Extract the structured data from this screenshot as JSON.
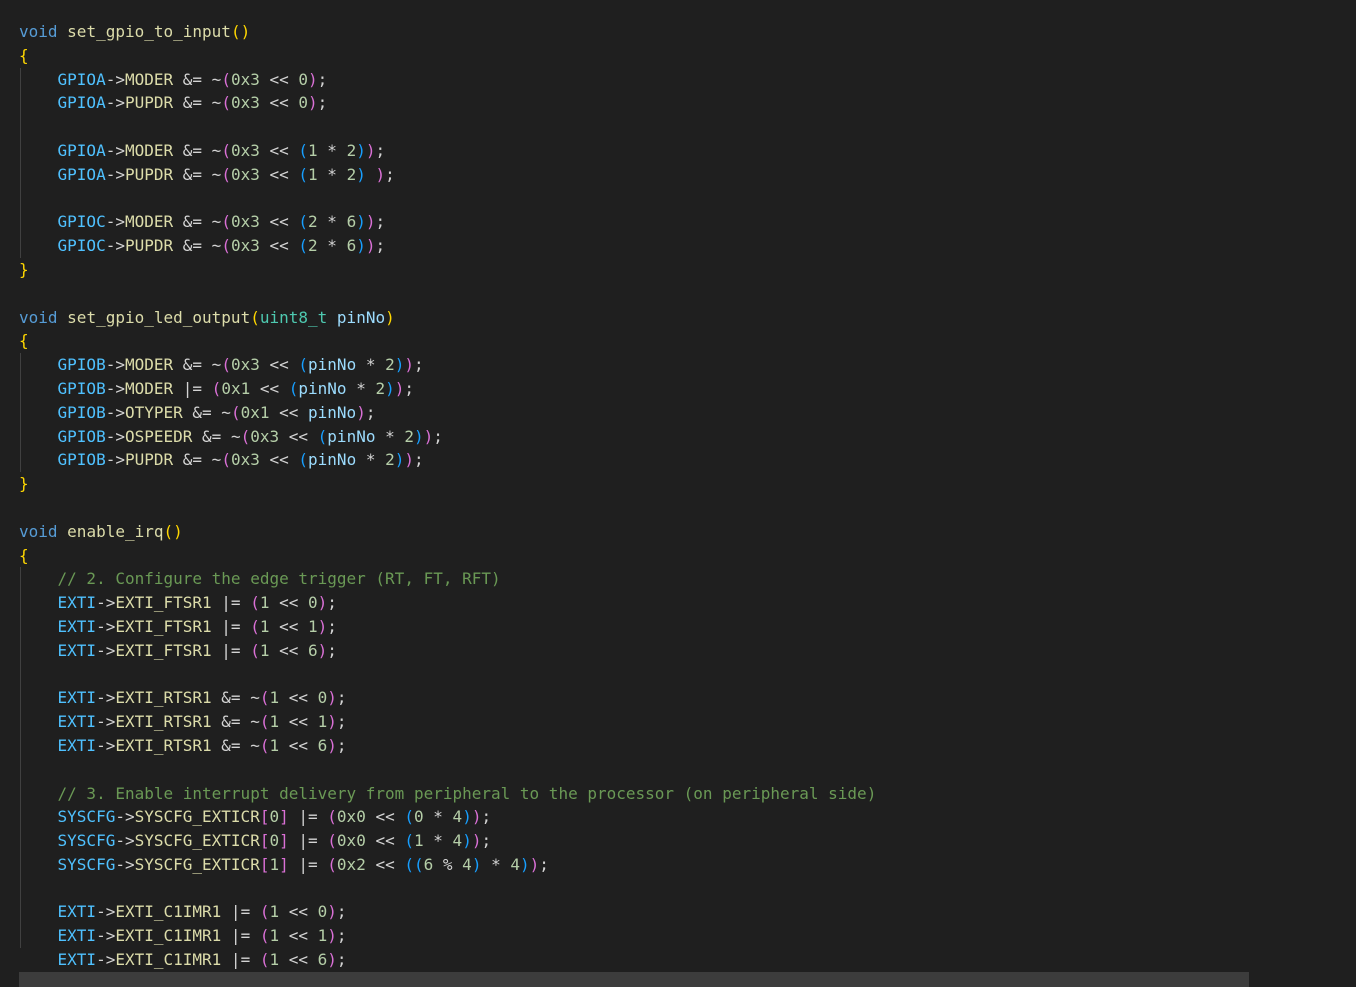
{
  "colors": {
    "background": "#1f1f1f",
    "keyword": "#569cd6",
    "function": "#dcdcaa",
    "type": "#4ec9b0",
    "variable": "#9cdcfe",
    "constant": "#4fc1ff",
    "member": "#dcdcaa",
    "number": "#b5cea8",
    "comment": "#6a9955",
    "bracket_level1": "#ffd700",
    "bracket_level2": "#da70d6",
    "bracket_level3": "#179fff"
  },
  "code_lines": [
    [
      [
        "kw",
        "void"
      ],
      [
        "plain",
        " "
      ],
      [
        "fn",
        "set_gpio_to_input"
      ],
      [
        "br1",
        "()"
      ]
    ],
    [
      [
        "br1",
        "{"
      ]
    ],
    [
      [
        "plain",
        "    "
      ],
      [
        "const",
        "GPIOA"
      ],
      [
        "op",
        "->"
      ],
      [
        "mem",
        "MODER"
      ],
      [
        "op",
        " &= ~"
      ],
      [
        "br2",
        "("
      ],
      [
        "num",
        "0x3"
      ],
      [
        "op",
        " << "
      ],
      [
        "num",
        "0"
      ],
      [
        "br2",
        ")"
      ],
      [
        "op",
        ";"
      ]
    ],
    [
      [
        "plain",
        "    "
      ],
      [
        "const",
        "GPIOA"
      ],
      [
        "op",
        "->"
      ],
      [
        "mem",
        "PUPDR"
      ],
      [
        "op",
        " &= ~"
      ],
      [
        "br2",
        "("
      ],
      [
        "num",
        "0x3"
      ],
      [
        "op",
        " << "
      ],
      [
        "num",
        "0"
      ],
      [
        "br2",
        ")"
      ],
      [
        "op",
        ";"
      ]
    ],
    [],
    [
      [
        "plain",
        "    "
      ],
      [
        "const",
        "GPIOA"
      ],
      [
        "op",
        "->"
      ],
      [
        "mem",
        "MODER"
      ],
      [
        "op",
        " &= ~"
      ],
      [
        "br2",
        "("
      ],
      [
        "num",
        "0x3"
      ],
      [
        "op",
        " << "
      ],
      [
        "br3",
        "("
      ],
      [
        "num",
        "1"
      ],
      [
        "op",
        " * "
      ],
      [
        "num",
        "2"
      ],
      [
        "br3",
        ")"
      ],
      [
        "br2",
        ")"
      ],
      [
        "op",
        ";"
      ]
    ],
    [
      [
        "plain",
        "    "
      ],
      [
        "const",
        "GPIOA"
      ],
      [
        "op",
        "->"
      ],
      [
        "mem",
        "PUPDR"
      ],
      [
        "op",
        " &= ~"
      ],
      [
        "br2",
        "("
      ],
      [
        "num",
        "0x3"
      ],
      [
        "op",
        " << "
      ],
      [
        "br3",
        "("
      ],
      [
        "num",
        "1"
      ],
      [
        "op",
        " * "
      ],
      [
        "num",
        "2"
      ],
      [
        "br3",
        ")"
      ],
      [
        "plain",
        " "
      ],
      [
        "br2",
        ")"
      ],
      [
        "op",
        ";"
      ]
    ],
    [],
    [
      [
        "plain",
        "    "
      ],
      [
        "const",
        "GPIOC"
      ],
      [
        "op",
        "->"
      ],
      [
        "mem",
        "MODER"
      ],
      [
        "op",
        " &= ~"
      ],
      [
        "br2",
        "("
      ],
      [
        "num",
        "0x3"
      ],
      [
        "op",
        " << "
      ],
      [
        "br3",
        "("
      ],
      [
        "num",
        "2"
      ],
      [
        "op",
        " * "
      ],
      [
        "num",
        "6"
      ],
      [
        "br3",
        ")"
      ],
      [
        "br2",
        ")"
      ],
      [
        "op",
        ";"
      ]
    ],
    [
      [
        "plain",
        "    "
      ],
      [
        "const",
        "GPIOC"
      ],
      [
        "op",
        "->"
      ],
      [
        "mem",
        "PUPDR"
      ],
      [
        "op",
        " &= ~"
      ],
      [
        "br2",
        "("
      ],
      [
        "num",
        "0x3"
      ],
      [
        "op",
        " << "
      ],
      [
        "br3",
        "("
      ],
      [
        "num",
        "2"
      ],
      [
        "op",
        " * "
      ],
      [
        "num",
        "6"
      ],
      [
        "br3",
        ")"
      ],
      [
        "br2",
        ")"
      ],
      [
        "op",
        ";"
      ]
    ],
    [
      [
        "br1",
        "}"
      ]
    ],
    [],
    [
      [
        "kw",
        "void"
      ],
      [
        "plain",
        " "
      ],
      [
        "fn",
        "set_gpio_led_output"
      ],
      [
        "br1",
        "("
      ],
      [
        "type",
        "uint8_t"
      ],
      [
        "plain",
        " "
      ],
      [
        "var",
        "pinNo"
      ],
      [
        "br1",
        ")"
      ]
    ],
    [
      [
        "br1",
        "{"
      ]
    ],
    [
      [
        "plain",
        "    "
      ],
      [
        "const",
        "GPIOB"
      ],
      [
        "op",
        "->"
      ],
      [
        "mem",
        "MODER"
      ],
      [
        "op",
        " &= ~"
      ],
      [
        "br2",
        "("
      ],
      [
        "num",
        "0x3"
      ],
      [
        "op",
        " << "
      ],
      [
        "br3",
        "("
      ],
      [
        "var",
        "pinNo"
      ],
      [
        "op",
        " * "
      ],
      [
        "num",
        "2"
      ],
      [
        "br3",
        ")"
      ],
      [
        "br2",
        ")"
      ],
      [
        "op",
        ";"
      ]
    ],
    [
      [
        "plain",
        "    "
      ],
      [
        "const",
        "GPIOB"
      ],
      [
        "op",
        "->"
      ],
      [
        "mem",
        "MODER"
      ],
      [
        "op",
        " |= "
      ],
      [
        "br2",
        "("
      ],
      [
        "num",
        "0x1"
      ],
      [
        "op",
        " << "
      ],
      [
        "br3",
        "("
      ],
      [
        "var",
        "pinNo"
      ],
      [
        "op",
        " * "
      ],
      [
        "num",
        "2"
      ],
      [
        "br3",
        ")"
      ],
      [
        "br2",
        ")"
      ],
      [
        "op",
        ";"
      ]
    ],
    [
      [
        "plain",
        "    "
      ],
      [
        "const",
        "GPIOB"
      ],
      [
        "op",
        "->"
      ],
      [
        "mem",
        "OTYPER"
      ],
      [
        "op",
        " &= ~"
      ],
      [
        "br2",
        "("
      ],
      [
        "num",
        "0x1"
      ],
      [
        "op",
        " << "
      ],
      [
        "var",
        "pinNo"
      ],
      [
        "br2",
        ")"
      ],
      [
        "op",
        ";"
      ]
    ],
    [
      [
        "plain",
        "    "
      ],
      [
        "const",
        "GPIOB"
      ],
      [
        "op",
        "->"
      ],
      [
        "mem",
        "OSPEEDR"
      ],
      [
        "op",
        " &= ~"
      ],
      [
        "br2",
        "("
      ],
      [
        "num",
        "0x3"
      ],
      [
        "op",
        " << "
      ],
      [
        "br3",
        "("
      ],
      [
        "var",
        "pinNo"
      ],
      [
        "op",
        " * "
      ],
      [
        "num",
        "2"
      ],
      [
        "br3",
        ")"
      ],
      [
        "br2",
        ")"
      ],
      [
        "op",
        ";"
      ]
    ],
    [
      [
        "plain",
        "    "
      ],
      [
        "const",
        "GPIOB"
      ],
      [
        "op",
        "->"
      ],
      [
        "mem",
        "PUPDR"
      ],
      [
        "op",
        " &= ~"
      ],
      [
        "br2",
        "("
      ],
      [
        "num",
        "0x3"
      ],
      [
        "op",
        " << "
      ],
      [
        "br3",
        "("
      ],
      [
        "var",
        "pinNo"
      ],
      [
        "op",
        " * "
      ],
      [
        "num",
        "2"
      ],
      [
        "br3",
        ")"
      ],
      [
        "br2",
        ")"
      ],
      [
        "op",
        ";"
      ]
    ],
    [
      [
        "br1",
        "}"
      ]
    ],
    [],
    [
      [
        "kw",
        "void"
      ],
      [
        "plain",
        " "
      ],
      [
        "fn",
        "enable_irq"
      ],
      [
        "br1",
        "()"
      ]
    ],
    [
      [
        "br1",
        "{"
      ]
    ],
    [
      [
        "plain",
        "    "
      ],
      [
        "comment",
        "// 2. Configure the edge trigger (RT, FT, RFT)"
      ]
    ],
    [
      [
        "plain",
        "    "
      ],
      [
        "const",
        "EXTI"
      ],
      [
        "op",
        "->"
      ],
      [
        "mem",
        "EXTI_FTSR1"
      ],
      [
        "op",
        " |= "
      ],
      [
        "br2",
        "("
      ],
      [
        "num",
        "1"
      ],
      [
        "op",
        " << "
      ],
      [
        "num",
        "0"
      ],
      [
        "br2",
        ")"
      ],
      [
        "op",
        ";"
      ]
    ],
    [
      [
        "plain",
        "    "
      ],
      [
        "const",
        "EXTI"
      ],
      [
        "op",
        "->"
      ],
      [
        "mem",
        "EXTI_FTSR1"
      ],
      [
        "op",
        " |= "
      ],
      [
        "br2",
        "("
      ],
      [
        "num",
        "1"
      ],
      [
        "op",
        " << "
      ],
      [
        "num",
        "1"
      ],
      [
        "br2",
        ")"
      ],
      [
        "op",
        ";"
      ]
    ],
    [
      [
        "plain",
        "    "
      ],
      [
        "const",
        "EXTI"
      ],
      [
        "op",
        "->"
      ],
      [
        "mem",
        "EXTI_FTSR1"
      ],
      [
        "op",
        " |= "
      ],
      [
        "br2",
        "("
      ],
      [
        "num",
        "1"
      ],
      [
        "op",
        " << "
      ],
      [
        "num",
        "6"
      ],
      [
        "br2",
        ")"
      ],
      [
        "op",
        ";"
      ]
    ],
    [],
    [
      [
        "plain",
        "    "
      ],
      [
        "const",
        "EXTI"
      ],
      [
        "op",
        "->"
      ],
      [
        "mem",
        "EXTI_RTSR1"
      ],
      [
        "op",
        " &= ~"
      ],
      [
        "br2",
        "("
      ],
      [
        "num",
        "1"
      ],
      [
        "op",
        " << "
      ],
      [
        "num",
        "0"
      ],
      [
        "br2",
        ")"
      ],
      [
        "op",
        ";"
      ]
    ],
    [
      [
        "plain",
        "    "
      ],
      [
        "const",
        "EXTI"
      ],
      [
        "op",
        "->"
      ],
      [
        "mem",
        "EXTI_RTSR1"
      ],
      [
        "op",
        " &= ~"
      ],
      [
        "br2",
        "("
      ],
      [
        "num",
        "1"
      ],
      [
        "op",
        " << "
      ],
      [
        "num",
        "1"
      ],
      [
        "br2",
        ")"
      ],
      [
        "op",
        ";"
      ]
    ],
    [
      [
        "plain",
        "    "
      ],
      [
        "const",
        "EXTI"
      ],
      [
        "op",
        "->"
      ],
      [
        "mem",
        "EXTI_RTSR1"
      ],
      [
        "op",
        " &= ~"
      ],
      [
        "br2",
        "("
      ],
      [
        "num",
        "1"
      ],
      [
        "op",
        " << "
      ],
      [
        "num",
        "6"
      ],
      [
        "br2",
        ")"
      ],
      [
        "op",
        ";"
      ]
    ],
    [],
    [
      [
        "plain",
        "    "
      ],
      [
        "comment",
        "// 3. Enable interrupt delivery from peripheral to the processor (on peripheral side)"
      ]
    ],
    [
      [
        "plain",
        "    "
      ],
      [
        "const",
        "SYSCFG"
      ],
      [
        "op",
        "->"
      ],
      [
        "mem",
        "SYSCFG_EXTICR"
      ],
      [
        "br2",
        "["
      ],
      [
        "num",
        "0"
      ],
      [
        "br2",
        "]"
      ],
      [
        "op",
        " |= "
      ],
      [
        "br2",
        "("
      ],
      [
        "num",
        "0x0"
      ],
      [
        "op",
        " << "
      ],
      [
        "br3",
        "("
      ],
      [
        "num",
        "0"
      ],
      [
        "op",
        " * "
      ],
      [
        "num",
        "4"
      ],
      [
        "br3",
        ")"
      ],
      [
        "br2",
        ")"
      ],
      [
        "op",
        ";"
      ]
    ],
    [
      [
        "plain",
        "    "
      ],
      [
        "const",
        "SYSCFG"
      ],
      [
        "op",
        "->"
      ],
      [
        "mem",
        "SYSCFG_EXTICR"
      ],
      [
        "br2",
        "["
      ],
      [
        "num",
        "0"
      ],
      [
        "br2",
        "]"
      ],
      [
        "op",
        " |= "
      ],
      [
        "br2",
        "("
      ],
      [
        "num",
        "0x0"
      ],
      [
        "op",
        " << "
      ],
      [
        "br3",
        "("
      ],
      [
        "num",
        "1"
      ],
      [
        "op",
        " * "
      ],
      [
        "num",
        "4"
      ],
      [
        "br3",
        ")"
      ],
      [
        "br2",
        ")"
      ],
      [
        "op",
        ";"
      ]
    ],
    [
      [
        "plain",
        "    "
      ],
      [
        "const",
        "SYSCFG"
      ],
      [
        "op",
        "->"
      ],
      [
        "mem",
        "SYSCFG_EXTICR"
      ],
      [
        "br2",
        "["
      ],
      [
        "num",
        "1"
      ],
      [
        "br2",
        "]"
      ],
      [
        "op",
        " |= "
      ],
      [
        "br2",
        "("
      ],
      [
        "num",
        "0x2"
      ],
      [
        "op",
        " << "
      ],
      [
        "br3",
        "(("
      ],
      [
        "num",
        "6"
      ],
      [
        "op",
        " % "
      ],
      [
        "num",
        "4"
      ],
      [
        "br3",
        ")"
      ],
      [
        "op",
        " * "
      ],
      [
        "num",
        "4"
      ],
      [
        "br3",
        ")"
      ],
      [
        "br2",
        ")"
      ],
      [
        "op",
        ";"
      ]
    ],
    [],
    [
      [
        "plain",
        "    "
      ],
      [
        "const",
        "EXTI"
      ],
      [
        "op",
        "->"
      ],
      [
        "mem",
        "EXTI_C1IMR1"
      ],
      [
        "op",
        " |= "
      ],
      [
        "br2",
        "("
      ],
      [
        "num",
        "1"
      ],
      [
        "op",
        " << "
      ],
      [
        "num",
        "0"
      ],
      [
        "br2",
        ")"
      ],
      [
        "op",
        ";"
      ]
    ],
    [
      [
        "plain",
        "    "
      ],
      [
        "const",
        "EXTI"
      ],
      [
        "op",
        "->"
      ],
      [
        "mem",
        "EXTI_C1IMR1"
      ],
      [
        "op",
        " |= "
      ],
      [
        "br2",
        "("
      ],
      [
        "num",
        "1"
      ],
      [
        "op",
        " << "
      ],
      [
        "num",
        "1"
      ],
      [
        "br2",
        ")"
      ],
      [
        "op",
        ";"
      ]
    ],
    [
      [
        "plain",
        "    "
      ],
      [
        "const",
        "EXTI"
      ],
      [
        "op",
        "->"
      ],
      [
        "mem",
        "EXTI_C1IMR1"
      ],
      [
        "op",
        " |= "
      ],
      [
        "br2",
        "("
      ],
      [
        "num",
        "1"
      ],
      [
        "op",
        " << "
      ],
      [
        "num",
        "6"
      ],
      [
        "br2",
        ")"
      ],
      [
        "op",
        ";"
      ]
    ]
  ]
}
